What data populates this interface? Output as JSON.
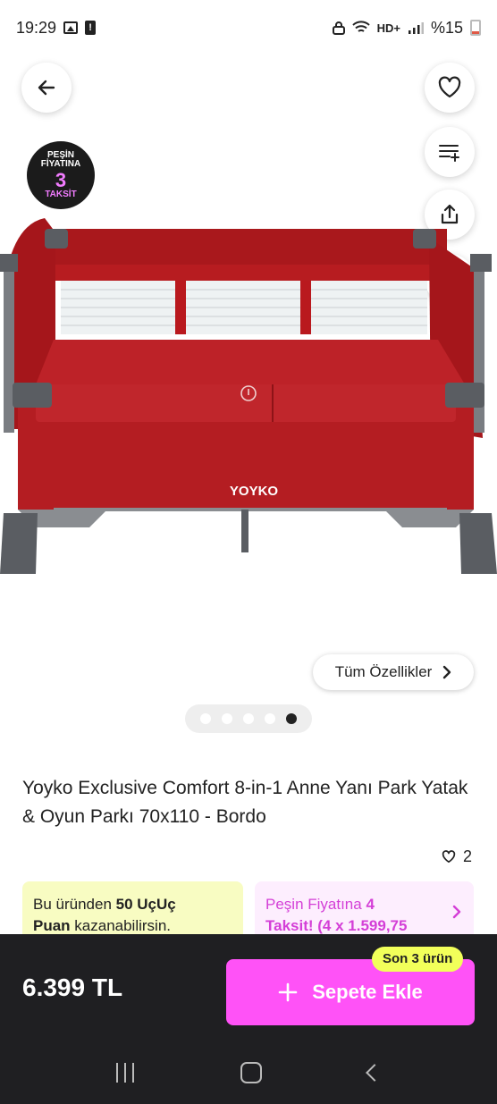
{
  "status_bar": {
    "time": "19:29",
    "battery": "%15",
    "network": "HD+"
  },
  "badge": {
    "line1": "PEŞİN",
    "line2": "FİYATINA",
    "number": "3",
    "line3": "TAKSİT"
  },
  "product_image": {
    "brand_logo": "YOYKO",
    "dominant_color": "#b31b1f"
  },
  "gallery": {
    "features_label": "Tüm Özellikler",
    "slide_count": 5,
    "active_slide": 5
  },
  "product": {
    "title": "Yoyko Exclusive Comfort 8-in-1 Anne Yanı Park Yatak & Oyun Parkı 70x110 - Bordo",
    "favorite_count": "2"
  },
  "promo_points": {
    "text_before": "Bu üründen ",
    "points": "50 UçUç",
    "points_unit": "Puan",
    "text_after": " kazanabilirsin."
  },
  "promo_installment": {
    "text": "Peşin Fiyatına ",
    "count_bold": "4",
    "line2_bold": "Taksit!",
    "line2_rest": " (4 x 1.599,75"
  },
  "bottom_bar": {
    "price": "6.399 TL",
    "add_to_cart_label": "Sepete Ekle",
    "stock_badge": "Son 3 ürün"
  },
  "colors": {
    "accent_pink": "#ff52f7",
    "badge_yellow": "#f2ff5a",
    "bar_dark": "#1f1f22"
  }
}
